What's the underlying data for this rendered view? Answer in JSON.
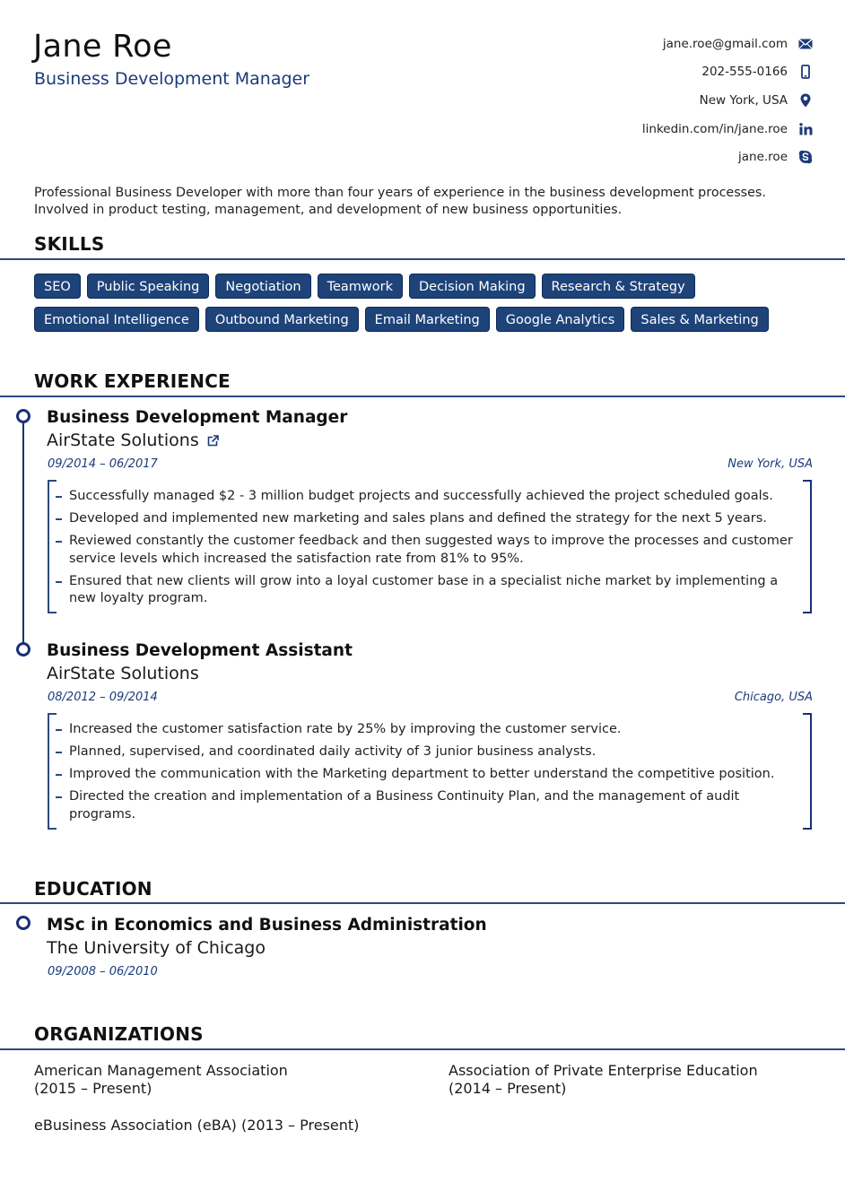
{
  "header": {
    "name": "Jane Roe",
    "title": "Business Development Manager",
    "contacts": [
      {
        "text": "jane.roe@gmail.com",
        "icon": "envelope-icon"
      },
      {
        "text": "202-555-0166",
        "icon": "mobile-phone-icon"
      },
      {
        "text": "New York, USA",
        "icon": "map-marker-icon"
      },
      {
        "text": "linkedin.com/in/jane.roe",
        "icon": "linkedin-icon"
      },
      {
        "text": "jane.roe",
        "icon": "skype-icon"
      }
    ]
  },
  "summary": {
    "line1": "Professional Business Developer with more than four years of experience in the business development processes.",
    "line2": "Involved in product testing, management, and development of new business opportunities."
  },
  "skills": {
    "heading": "SKILLS",
    "row1": [
      "SEO",
      "Public Speaking",
      "Negotiation",
      "Teamwork",
      "Decision Making",
      "Research & Strategy"
    ],
    "row2": [
      "Emotional Intelligence",
      "Outbound Marketing",
      "Email Marketing",
      "Google Analytics",
      "Sales & Marketing"
    ]
  },
  "work": {
    "heading": "WORK EXPERIENCE",
    "entries": [
      {
        "title": "Business Development Manager",
        "company": "AirState Solutions",
        "has_link_icon": true,
        "dates": "09/2014 – 06/2017",
        "location": "New York, USA",
        "bullets": [
          "Successfully managed $2 - 3 million budget projects and successfully achieved the project scheduled goals.",
          "Developed and implemented new marketing and sales plans and defined the strategy for the next 5 years.",
          "Reviewed constantly the customer feedback and then suggested ways to improve the processes and customer service levels which increased the satisfaction rate from 81% to 95%.",
          "Ensured that new clients will grow into a loyal customer base in a specialist niche market by implementing a new loyalty program."
        ]
      },
      {
        "title": "Business Development Assistant",
        "company": "AirState Solutions",
        "has_link_icon": false,
        "dates": "08/2012 – 09/2014",
        "location": "Chicago, USA",
        "bullets": [
          "Increased the customer satisfaction rate by 25% by improving the customer service.",
          "Planned, supervised, and coordinated daily activity of 3 junior business analysts.",
          "Improved the communication with the Marketing department to better understand the competitive position.",
          "Directed the creation and implementation of a Business Continuity Plan, and the management of audit programs."
        ]
      }
    ]
  },
  "education": {
    "heading": "EDUCATION",
    "entries": [
      {
        "degree": "MSc in Economics and Business Administration",
        "school": "The University of Chicago",
        "dates": "09/2008 – 06/2010"
      }
    ]
  },
  "organizations": {
    "heading": "ORGANIZATIONS",
    "items": [
      {
        "name": "American Management Association",
        "period": "(2015 – Present)"
      },
      {
        "name": "Association of Private Enterprise Education",
        "period": "(2014 – Present)"
      },
      {
        "name": "eBusiness Association (eBA) (2013 – Present)",
        "period": ""
      }
    ]
  },
  "colors": {
    "accent": "#1b3a7a",
    "tag_background": "#1e4379",
    "tag_text": "#ffffff",
    "rule": "#2b4a7e"
  }
}
